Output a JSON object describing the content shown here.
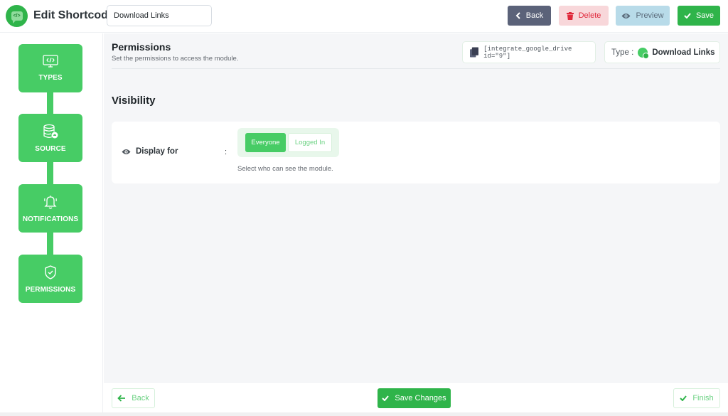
{
  "header": {
    "title": "Edit Shortcode",
    "shortcode_name": "Download Links",
    "buttons": {
      "back": "Back",
      "delete": "Delete",
      "preview": "Preview",
      "save": "Save"
    }
  },
  "sidebar": {
    "steps": [
      {
        "label": "TYPES",
        "icon": "code-monitor-icon"
      },
      {
        "label": "SOURCE",
        "icon": "database-cloud-icon"
      },
      {
        "label": "NOTIFICATIONS",
        "icon": "bell-icon"
      },
      {
        "label": "PERMISSIONS",
        "icon": "shield-check-icon"
      }
    ]
  },
  "section": {
    "title": "Permissions",
    "subtitle": "Set the permissions to access the module.",
    "shortcode": "[integrate_google_drive id=\"9\"]",
    "type_label": "Type :",
    "type_value": "Download Links"
  },
  "visibility": {
    "title": "Visibility",
    "field_label": "Display for",
    "colon": ":",
    "options": [
      "Everyone",
      "Logged In"
    ],
    "selected": "Everyone",
    "helper": "Select who can see the module."
  },
  "footer": {
    "back": "Back",
    "save_changes": "Save Changes",
    "finish": "Finish"
  },
  "colors": {
    "primary": "#2fb44a",
    "step": "#47cc65",
    "delete": "#e0283b",
    "back": "#5b6279"
  }
}
